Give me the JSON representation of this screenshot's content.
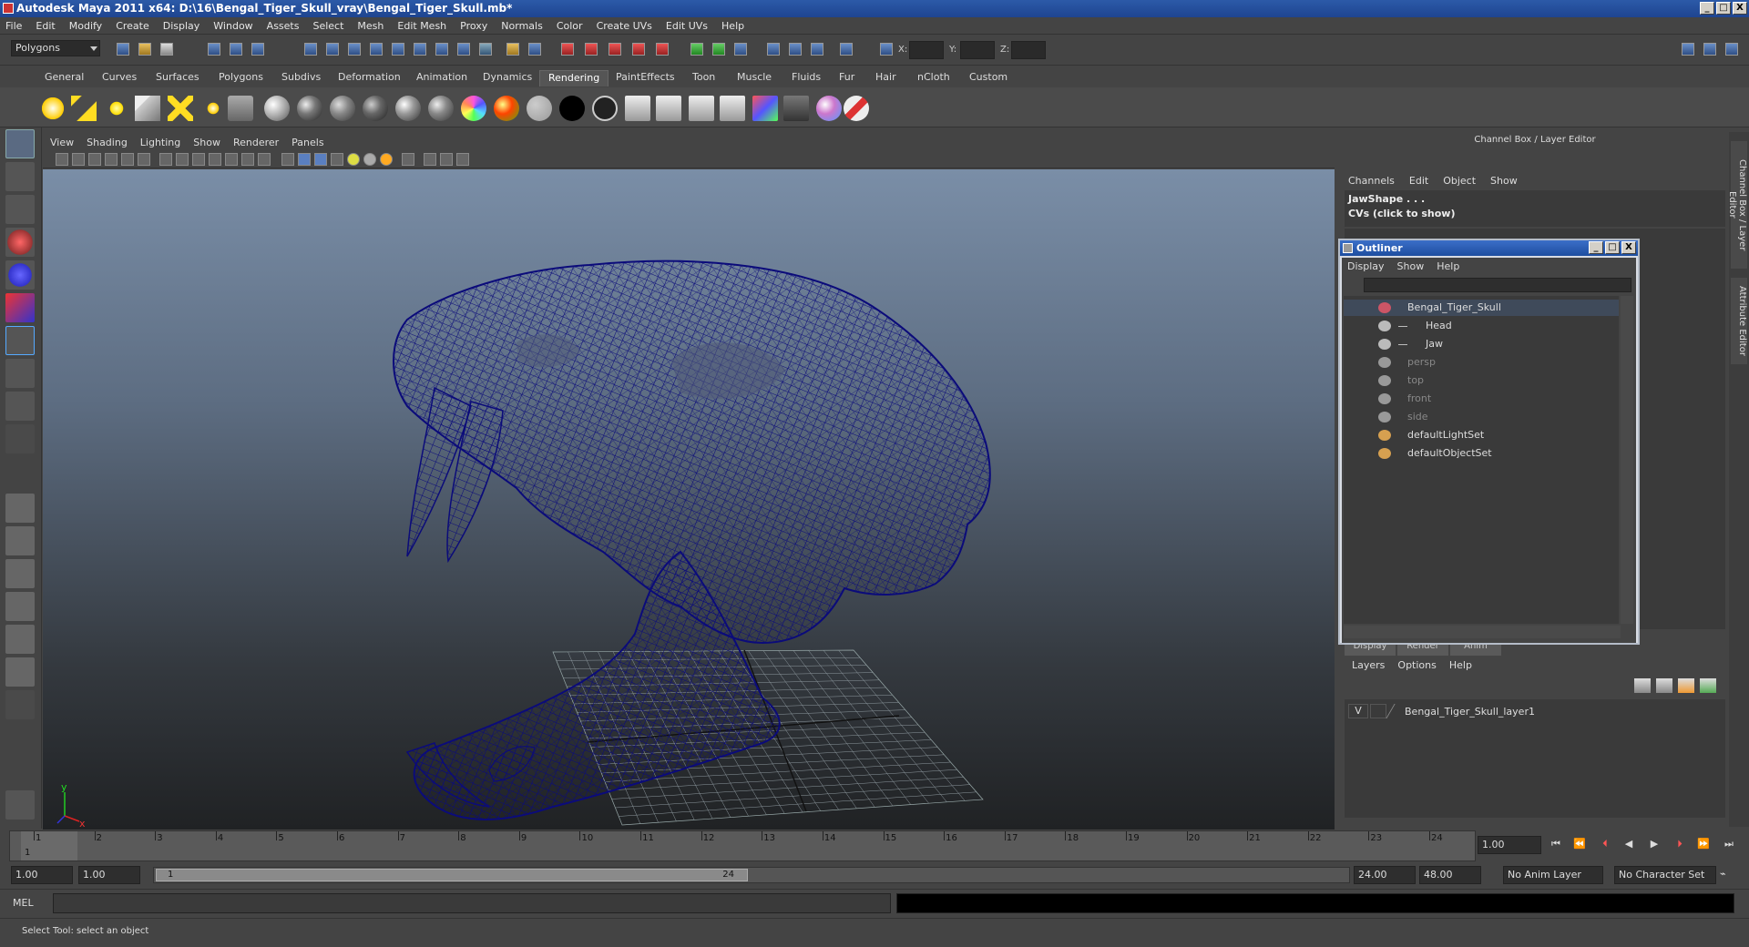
{
  "window": {
    "title": "Autodesk Maya 2011 x64: D:\\16\\Bengal_Tiger_Skull_vray\\Bengal_Tiger_Skull.mb*",
    "min": "_",
    "max": "□",
    "close": "X"
  },
  "menubar": [
    "File",
    "Edit",
    "Modify",
    "Create",
    "Display",
    "Window",
    "Assets",
    "Select",
    "Mesh",
    "Edit Mesh",
    "Proxy",
    "Normals",
    "Color",
    "Create UVs",
    "Edit UVs",
    "Help"
  ],
  "statusline": {
    "menu_set": "Polygons",
    "x_label": "X:",
    "y_label": "Y:",
    "z_label": "Z:"
  },
  "shelf": {
    "tabs": [
      "General",
      "Curves",
      "Surfaces",
      "Polygons",
      "Subdivs",
      "Deformation",
      "Animation",
      "Dynamics",
      "Rendering",
      "PaintEffects",
      "Toon",
      "Muscle",
      "Fluids",
      "Fur",
      "Hair",
      "nCloth",
      "Custom"
    ],
    "active_tab": "Rendering"
  },
  "viewport": {
    "menu": [
      "View",
      "Shading",
      "Lighting",
      "Show",
      "Renderer",
      "Panels"
    ],
    "axis_y": "y",
    "axis_x": "x",
    "wire_color": "#0a0a6e"
  },
  "channel_box": {
    "title": "Channel Box / Layer Editor",
    "menu": [
      "Channels",
      "Edit",
      "Object",
      "Show"
    ],
    "object_name": "JawShape . . .",
    "cvs_hint": "CVs (click to show)"
  },
  "outliner": {
    "title": "Outliner",
    "menu": [
      "Display",
      "Show",
      "Help"
    ],
    "items": [
      {
        "label": "Bengal_Tiger_Skull",
        "indent": 0,
        "selected": true,
        "dim": false,
        "icon": "transform-icon"
      },
      {
        "label": "Head",
        "indent": 1,
        "selected": false,
        "dim": false,
        "icon": "mesh-icon"
      },
      {
        "label": "Jaw",
        "indent": 1,
        "selected": false,
        "dim": false,
        "icon": "mesh-icon"
      },
      {
        "label": "persp",
        "indent": 0,
        "selected": false,
        "dim": true,
        "icon": "camera-icon"
      },
      {
        "label": "top",
        "indent": 0,
        "selected": false,
        "dim": true,
        "icon": "camera-icon"
      },
      {
        "label": "front",
        "indent": 0,
        "selected": false,
        "dim": true,
        "icon": "camera-icon"
      },
      {
        "label": "side",
        "indent": 0,
        "selected": false,
        "dim": true,
        "icon": "camera-icon"
      },
      {
        "label": "defaultLightSet",
        "indent": 0,
        "selected": false,
        "dim": false,
        "icon": "set-icon"
      },
      {
        "label": "defaultObjectSet",
        "indent": 0,
        "selected": false,
        "dim": false,
        "icon": "set-icon"
      }
    ]
  },
  "layer_editor": {
    "tabs": [
      "Display",
      "Render",
      "Anim"
    ],
    "menu": [
      "Layers",
      "Options",
      "Help"
    ],
    "layer_visible": "V",
    "layer_name": "Bengal_Tiger_Skull_layer1"
  },
  "edge_tabs": {
    "channel_box": "Channel Box / Layer Editor",
    "attribute_editor": "Attribute Editor"
  },
  "timeline": {
    "ticks": [
      "1",
      "2",
      "3",
      "4",
      "5",
      "6",
      "7",
      "8",
      "9",
      "10",
      "11",
      "12",
      "13",
      "14",
      "15",
      "16",
      "17",
      "18",
      "19",
      "20",
      "21",
      "22",
      "23",
      "24"
    ],
    "current_frame_marker": "1",
    "current_time": "1.00"
  },
  "range": {
    "start": "1.00",
    "playback_start": "1.00",
    "handle_start": "1",
    "handle_end": "24",
    "playback_end": "24.00",
    "end": "48.00",
    "anim_layer": "No Anim Layer",
    "character_set": "No Character Set"
  },
  "cmdline": {
    "label": "MEL"
  },
  "helpline": {
    "text": "Select Tool: select an object"
  }
}
